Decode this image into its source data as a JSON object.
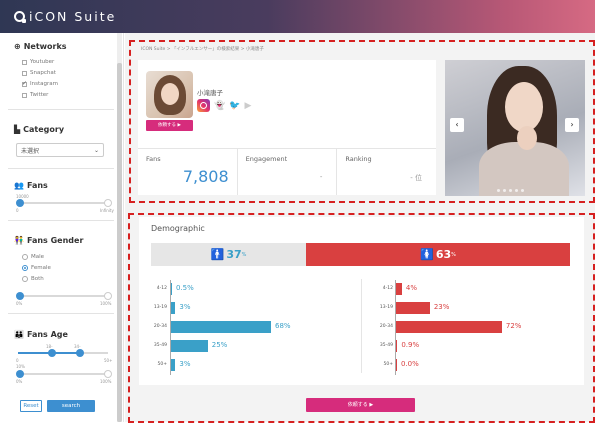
{
  "app": {
    "title": "iCON Suite"
  },
  "sidebar": {
    "networks": {
      "title": "Networks",
      "items": [
        {
          "label": "Youtuber",
          "checked": false
        },
        {
          "label": "Snapchat",
          "checked": false
        },
        {
          "label": "Instagram",
          "checked": true
        },
        {
          "label": "Twitter",
          "checked": false
        }
      ]
    },
    "category": {
      "title": "Category",
      "selected": "未選択"
    },
    "fans": {
      "title": "Fans",
      "min_label": "0",
      "max_label": "Infinity",
      "top_label": "10000"
    },
    "fans_gender": {
      "title": "Fans Gender",
      "options": [
        {
          "label": "Male",
          "selected": false
        },
        {
          "label": "Female",
          "selected": true
        },
        {
          "label": "Both",
          "selected": false
        }
      ],
      "min_label": "0%",
      "max_label": "100%"
    },
    "fans_age": {
      "title": "Fans Age",
      "range_low_label": "18-",
      "range_high_label": "34-",
      "min_label": "0",
      "max_label": "50+",
      "pct_min_label": "0%",
      "pct_max_label": "100%",
      "mid_label": "10%"
    },
    "reset_label": "Reset",
    "search_label": "search"
  },
  "breadcrumb": "ICON Suite  >  「インフルエンサー」の検索結果  >  小滝唐子",
  "profile": {
    "name": "小滝唐子",
    "request_button": "依頼する ▶",
    "stats": [
      {
        "label": "Fans",
        "value": "7,808"
      },
      {
        "label": "Engagement",
        "value": "-"
      },
      {
        "label": "Ranking",
        "value": "- 位"
      }
    ]
  },
  "carousel": {
    "prev": "‹",
    "next": "›"
  },
  "demographic": {
    "title": "Demographic",
    "male_pct": "37",
    "female_pct": "63",
    "pct_unit": "%",
    "age_groups": [
      "4-12",
      "13-19",
      "20-34",
      "35-49",
      "50+"
    ],
    "male_values": [
      "0.5%",
      "3%",
      "68%",
      "25%",
      "3%"
    ],
    "female_values": [
      "4%",
      "23%",
      "72%",
      "0.9%",
      "0.0%"
    ],
    "male_numeric": [
      0.5,
      3,
      68,
      25,
      3
    ],
    "female_numeric": [
      4,
      23,
      72,
      0.9,
      0
    ]
  },
  "bottom_button": "依頼する ▶",
  "colors": {
    "male": "#3aa0c8",
    "female": "#d94040",
    "accent": "#d62c7c",
    "primary": "#3d8fd0"
  }
}
